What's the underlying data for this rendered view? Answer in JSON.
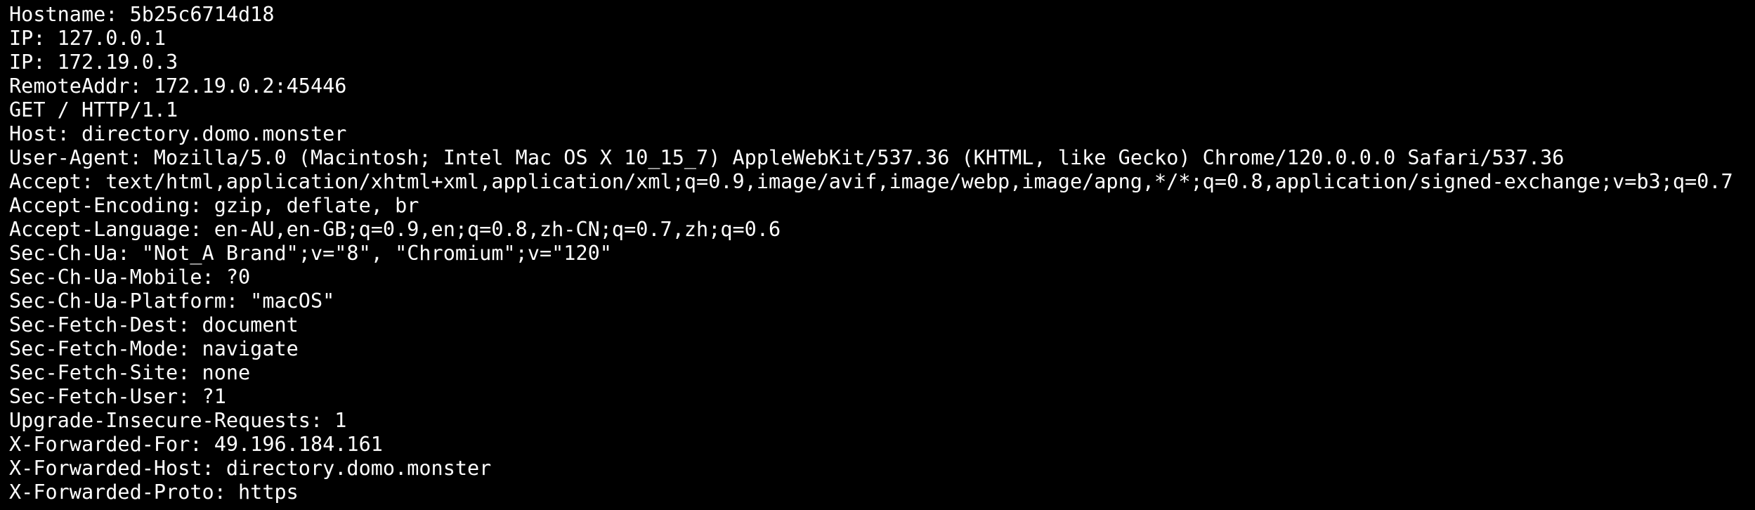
{
  "colors": {
    "background": "#000000",
    "text": "#ffffff"
  },
  "response": {
    "lines": [
      "Hostname: 5b25c6714d18",
      "IP: 127.0.0.1",
      "IP: 172.19.0.3",
      "RemoteAddr: 172.19.0.2:45446",
      "GET / HTTP/1.1",
      "Host: directory.domo.monster",
      "User-Agent: Mozilla/5.0 (Macintosh; Intel Mac OS X 10_15_7) AppleWebKit/537.36 (KHTML, like Gecko) Chrome/120.0.0.0 Safari/537.36",
      "Accept: text/html,application/xhtml+xml,application/xml;q=0.9,image/avif,image/webp,image/apng,*/*;q=0.8,application/signed-exchange;v=b3;q=0.7",
      "Accept-Encoding: gzip, deflate, br",
      "Accept-Language: en-AU,en-GB;q=0.9,en;q=0.8,zh-CN;q=0.7,zh;q=0.6",
      "Sec-Ch-Ua: \"Not_A Brand\";v=\"8\", \"Chromium\";v=\"120\"",
      "Sec-Ch-Ua-Mobile: ?0",
      "Sec-Ch-Ua-Platform: \"macOS\"",
      "Sec-Fetch-Dest: document",
      "Sec-Fetch-Mode: navigate",
      "Sec-Fetch-Site: none",
      "Sec-Fetch-User: ?1",
      "Upgrade-Insecure-Requests: 1",
      "X-Forwarded-For: 49.196.184.161",
      "X-Forwarded-Host: directory.domo.monster",
      "X-Forwarded-Proto: https"
    ]
  }
}
